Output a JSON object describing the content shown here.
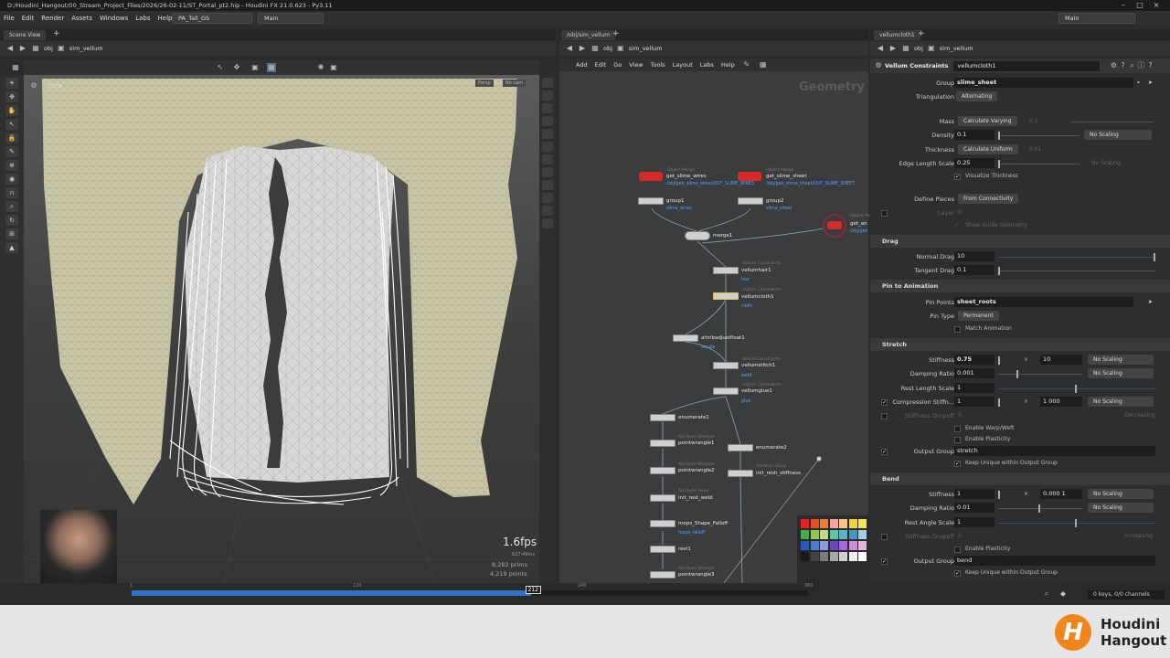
{
  "window": {
    "title": "D:/Houdini_Hangout/00_Stream_Project_Files/2026/26-02-11/ST_Portal_pt2.hip - Houdini FX 21.0.623 - Py3.11",
    "controls": [
      "–",
      "□",
      "×"
    ]
  },
  "menubar": {
    "items": [
      "File",
      "Edit",
      "Render",
      "Assets",
      "Windows",
      "Labs",
      "Help"
    ],
    "desktop_dropdown": "PA_Tall_GS",
    "context_dropdown": "Main",
    "right_dropdown": "Main"
  },
  "scene_view": {
    "tab": "Scene View",
    "path_obj": "obj",
    "path_node": "sim_vellum",
    "view_label": "View",
    "persp_label": "Persp",
    "cam_label": "No cam",
    "fps": "1.6fps",
    "ms": "627.49ms",
    "prims": "8,282  prims",
    "points": "4,219  points"
  },
  "network_view": {
    "tab": "/obj/sim_vellum",
    "path_obj": "obj",
    "path_node": "sim_vellum",
    "menu": [
      "Add",
      "Edit",
      "Go",
      "View",
      "Tools",
      "Layout",
      "Labs",
      "Help"
    ],
    "watermark": "Geometry",
    "nodes": {
      "om1_type": "Object Merge",
      "om1_name": "get_slime_wires",
      "om1_path": "/obj/geo_slime_wires/OUT_SLIME_WIRES",
      "om2_type": "Object Merge",
      "om2_name": "get_slime_sheet",
      "om2_path": "/obj/geo_slime_sheet/OUT_SLIME_SHEET",
      "om3_type": "Object Merge",
      "om3_name": "get_an",
      "om3_path": "/obj/geo",
      "group1": "group1",
      "group1_sub": "slime_wires",
      "group2": "group2",
      "group2_sub": "slime_sheet",
      "merge1": "merge1",
      "vh_type": "Vellum Constraints",
      "vh_name": "vellumhair1",
      "vh_sub": "hair",
      "vc_type": "Vellum Constraints",
      "vc_name": "vellumcloth1",
      "vc_sub": "cloth",
      "abf": "attribadjustfloat1",
      "abf_sub": "ascale",
      "vs_type": "Vellum Constraints",
      "vs_name": "vellumstitch1",
      "vs_sub": "weld",
      "vg_type": "Vellum Constraints",
      "vg_name": "vellumglue1",
      "vg_sub": "glue",
      "en1": "enumerate1",
      "pw1_type": "Attribute Wrangle",
      "pw1": "pointwrangle1",
      "en2": "enumerate2",
      "pw2_type": "Attribute Wrangle",
      "pw2": "pointwrangle2",
      "irs_type": "Attribute Swap",
      "irs": "init_resh_stiffness",
      "irw_type": "Attribute Swap",
      "irw": "init_rest_weld",
      "msf": "mops_Shape_Falloff",
      "msf_sub": "mops_falloff",
      "rest1": "rest1",
      "pw3_type": "Attribute Wrangle",
      "pw3": "pointwrangle3"
    },
    "palette_colors": [
      "#e62020",
      "#f04a1a",
      "#f07a3a",
      "#f4a6a0",
      "#f4c68a",
      "#f2d23a",
      "#f5e64a",
      "#4aa84a",
      "#8cc84a",
      "#bcdc7a",
      "#5ac8a0",
      "#5ab4c8",
      "#3a9ac8",
      "#a0d0f0",
      "#2a5ab4",
      "#4a7ad8",
      "#8a9ae8",
      "#6a4ab8",
      "#a46ad8",
      "#d488d8",
      "#e8b0e0",
      "#1a1a1a",
      "#444444",
      "#7a7a7a",
      "#a8a8a8",
      "#d0d0d0",
      "#eeeeee",
      "#ffffff"
    ]
  },
  "parameters": {
    "tab": "vellumcloth1",
    "path_obj": "obj",
    "path_node": "sim_vellum",
    "node_type": "Vellum Constraints",
    "node_name": "vellumcloth1",
    "group_label": "Group",
    "group_value": "slime_sheet",
    "triangulation_label": "Triangulation",
    "triangulation_value": "Alternating",
    "mass_label": "Mass",
    "mass_value": "Calculate Varying",
    "mass_dim": "0.1",
    "density_label": "Density",
    "density_value": "0.1",
    "density_scaling": "No Scaling",
    "thickness_label": "Thickness",
    "thickness_value": "Calculate Uniform",
    "thickness_dim": "0.01",
    "edge_label": "Edge Length Scale",
    "edge_value": "0.25",
    "edge_scaling": "No Scaling",
    "visualize": "Visualize Thickness",
    "define_label": "Define Pieces",
    "define_value": "From Connectivity",
    "layer_label": "Layer",
    "layer_value": "0",
    "guide_geo": "Show Guide Geometry",
    "drag_section": "Drag",
    "normal_drag_label": "Normal Drag",
    "normal_drag_value": "10",
    "tangent_drag_label": "Tangent Drag",
    "tangent_drag_value": "0.1",
    "pin_section": "Pin to Animation",
    "pin_points_label": "Pin Points",
    "pin_points_value": "sheet_roots",
    "pin_type_label": "Pin Type",
    "pin_type_value": "Permanent",
    "match_anim": "Match Animation",
    "stretch_section": "Stretch",
    "s_stiff_label": "Stiffness",
    "s_stiff_value": "0.75",
    "s_stiff_mult": "10",
    "s_stiff_scaling": "No Scaling",
    "s_damp_label": "Damping Ratio",
    "s_damp_value": "0.001",
    "s_damp_scaling": "No Scaling",
    "s_rest_label": "Rest Length Scale",
    "s_rest_value": "1",
    "s_comp_label": "Compression Stiffn...",
    "s_comp_value": "1",
    "s_comp_mult": "1 000",
    "s_comp_scaling": "No Scaling",
    "s_dropoff_label": "Stiffness Dropoff",
    "s_dropoff_value": "0",
    "s_dropoff_mode": "Decreasing",
    "enable_warp": "Enable Warp/Weft",
    "enable_plast1": "Enable Plasticity",
    "s_out_label": "Output Group",
    "s_out_value": "stretch",
    "s_keep": "Keep Unique within Output Group",
    "bend_section": "Bend",
    "b_stiff_label": "Stiffness",
    "b_stiff_value": "1",
    "b_stiff_mult": "0.000 1",
    "b_stiff_scaling": "No Scaling",
    "b_damp_label": "Damping Ratio",
    "b_damp_value": "0.01",
    "b_damp_scaling": "No Scaling",
    "b_rest_label": "Rest Angle Scale",
    "b_rest_value": "1",
    "b_dropoff_label": "Stiffness Dropoff",
    "b_dropoff_value": "0",
    "b_dropoff_mode": "Increasing",
    "enable_plast2": "Enable Plasticity",
    "b_out_label": "Output Group",
    "b_out_value": "bend",
    "b_keep": "Keep Unique within Output Group"
  },
  "timeline": {
    "frame_start": "1",
    "tick_120": "120",
    "tick_240": "240",
    "tick_360": "360",
    "current": "212",
    "progress": 0.59,
    "keys": "0 keys, 0/0 channels"
  },
  "branding": {
    "line1": "Houdini",
    "line2": "Hangout",
    "mark": "H"
  }
}
